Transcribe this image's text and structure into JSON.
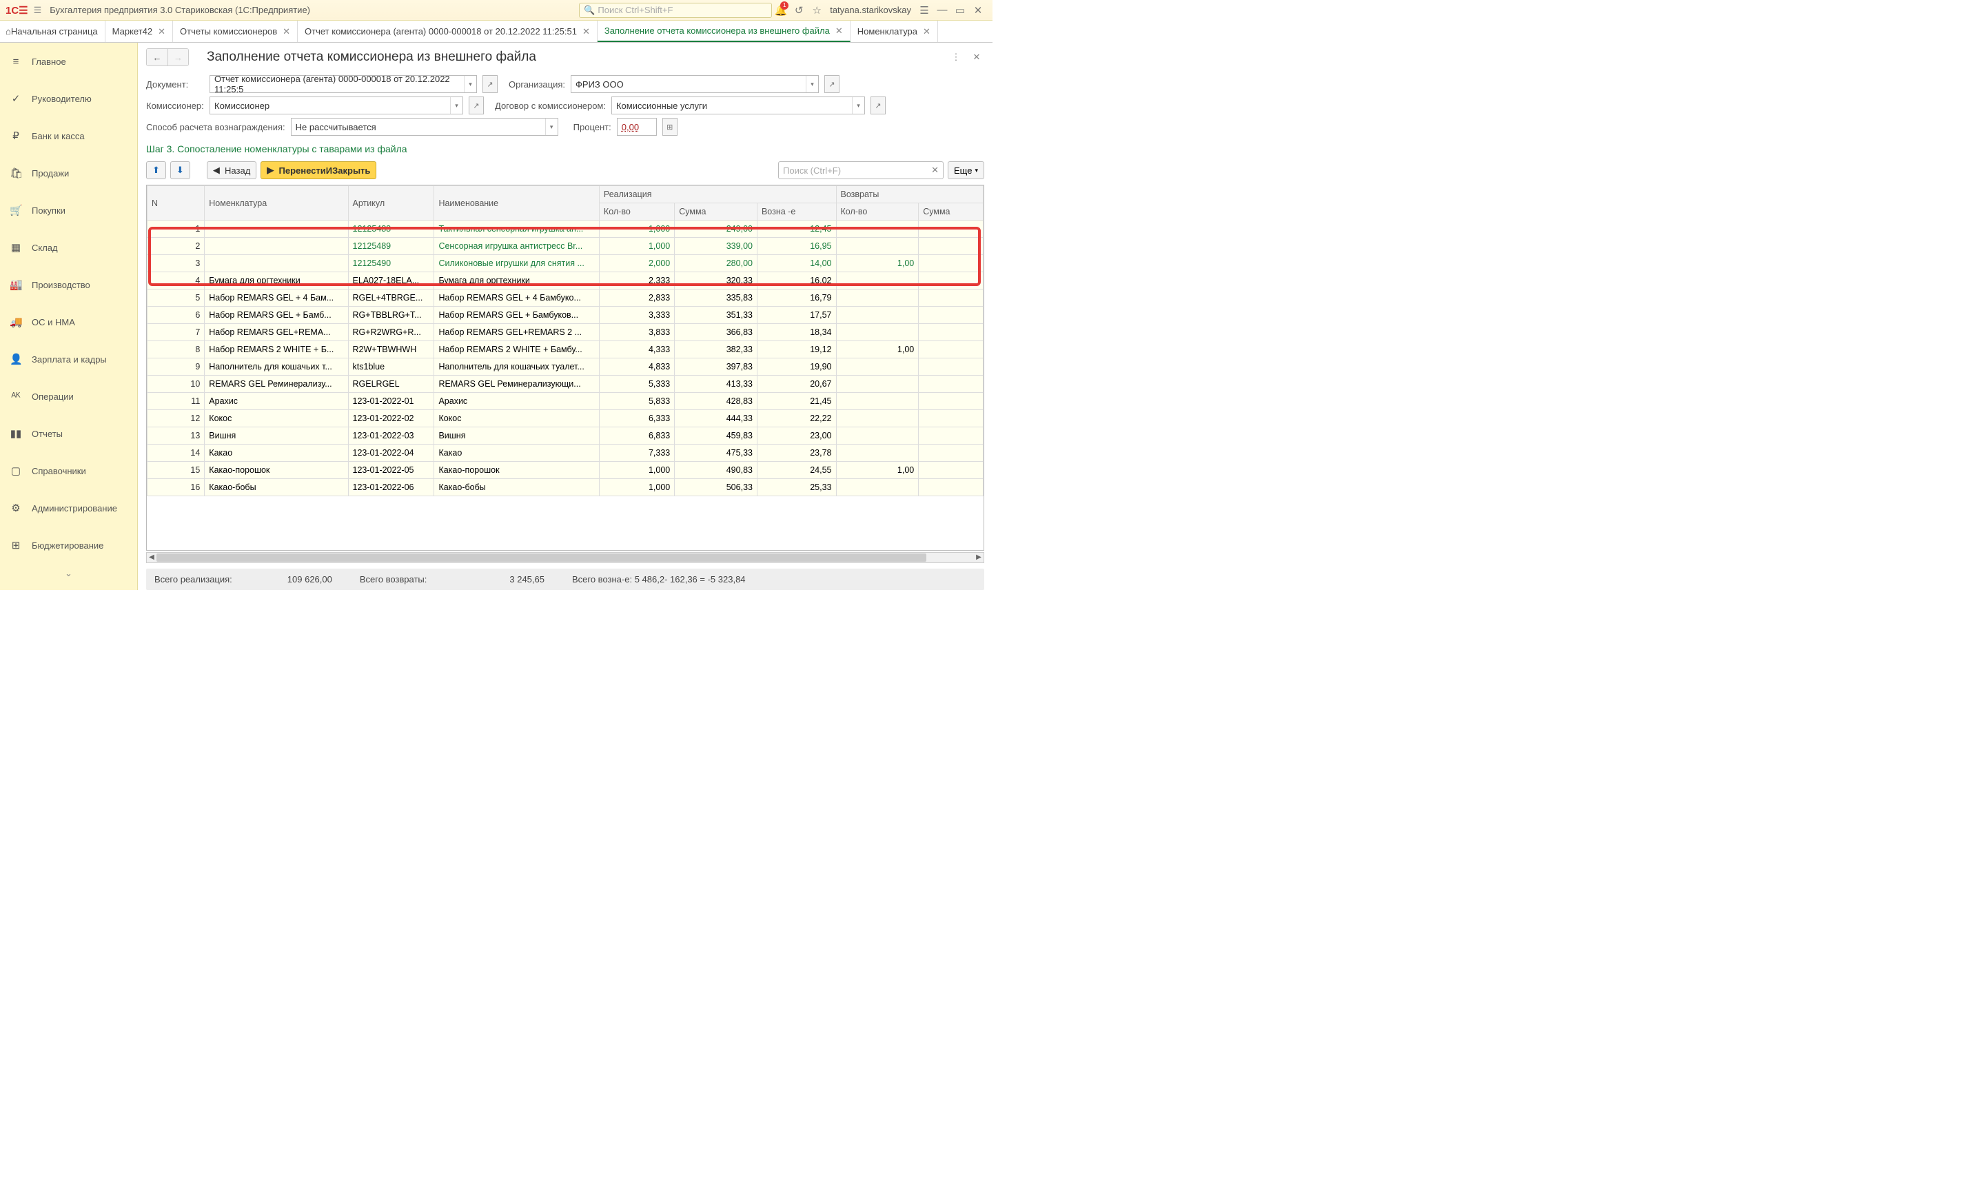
{
  "app": {
    "title": "Бухгалтерия предприятия 3.0 Стариковская  (1С:Предприятие)",
    "search_placeholder": "Поиск Ctrl+Shift+F",
    "username": "tatyana.starikovskay",
    "bell_badge": "1"
  },
  "tabs": [
    {
      "label": "Начальная страница",
      "closable": false,
      "home": true
    },
    {
      "label": "Маркет42",
      "closable": true
    },
    {
      "label": "Отчеты комиссионеров",
      "closable": true
    },
    {
      "label": "Отчет комиссионера (агента) 0000-000018 от 20.12.2022 11:25:51",
      "closable": true
    },
    {
      "label": "Заполнение  отчета комиссионера из внешнего  файла",
      "closable": true,
      "active": true
    },
    {
      "label": "Номенклатура",
      "closable": true
    }
  ],
  "sidebar": [
    {
      "icon": "≡",
      "label": "Главное"
    },
    {
      "icon": "✓",
      "label": "Руководителю"
    },
    {
      "icon": "₽",
      "label": "Банк и касса"
    },
    {
      "icon": "🛍",
      "label": "Продажи"
    },
    {
      "icon": "🛒",
      "label": "Покупки"
    },
    {
      "icon": "▦",
      "label": "Склад"
    },
    {
      "icon": "🏭",
      "label": "Производство"
    },
    {
      "icon": "🚚",
      "label": "ОС и НМА"
    },
    {
      "icon": "👤",
      "label": "Зарплата и кадры"
    },
    {
      "icon": "ᴬᴷ",
      "label": "Операции"
    },
    {
      "icon": "▮▮",
      "label": "Отчеты"
    },
    {
      "icon": "▢",
      "label": "Справочники"
    },
    {
      "icon": "⚙",
      "label": "Администрирование"
    },
    {
      "icon": "⊞",
      "label": "Бюджетирование"
    }
  ],
  "page": {
    "title": "Заполнение  отчета комиссионера из внешнего  файла",
    "labels": {
      "document": "Документ:",
      "organization": "Организация:",
      "commissioner": "Комиссионер:",
      "contract": "Договор с комиссионером:",
      "method": "Способ расчета вознаграждения:",
      "percent": "Процент:"
    },
    "values": {
      "document": "Отчет комиссионера (агента) 0000-000018 от 20.12.2022 11:25:5",
      "organization": "ФРИЗ ООО",
      "commissioner": "Комиссионер",
      "contract": "Комиссионные услуги",
      "method": "Не рассчитывается",
      "percent": "0,00"
    },
    "step": "Шаг 3. Сопосталение номенклатуры с таварами из файла",
    "buttons": {
      "back": "Назад",
      "transfer": "ПеренестиИЗакрыть",
      "search_ph": "Поиск (Ctrl+F)",
      "more": "Еще"
    }
  },
  "table": {
    "headers": {
      "n": "N",
      "nomen": "Номенклатура",
      "article": "Артикул",
      "name": "Наименование",
      "real": "Реализация",
      "qty": "Кол-во",
      "sum": "Сумма",
      "reward": "Возна -е",
      "returns": "Возвраты",
      "ret_qty": "Кол-во",
      "ret_sum": "Сумма"
    },
    "rows": [
      {
        "n": 1,
        "nomen": "",
        "article": "12125488",
        "name": "Тактильная сенсорная игрушка ан...",
        "qty": "1,000",
        "sum": "249,00",
        "reward": "12,45",
        "ret_qty": "",
        "green": true
      },
      {
        "n": 2,
        "nomen": "",
        "article": "12125489",
        "name": "Сенсорная игрушка антистресс Br...",
        "qty": "1,000",
        "sum": "339,00",
        "reward": "16,95",
        "ret_qty": "",
        "green": true
      },
      {
        "n": 3,
        "nomen": "",
        "article": "12125490",
        "name": "Силиконовые игрушки для снятия ...",
        "qty": "2,000",
        "sum": "280,00",
        "reward": "14,00",
        "ret_qty": "1,00",
        "green": true
      },
      {
        "n": 4,
        "nomen": "Бумага для оргтехники",
        "article": "ELA027-18ELA...",
        "name": "Бумага для оргтехники",
        "qty": "2,333",
        "sum": "320,33",
        "reward": "16,02",
        "ret_qty": ""
      },
      {
        "n": 5,
        "nomen": "Набор REMARS GEL + 4 Бам...",
        "article": "RGEL+4TBRGE...",
        "name": "Набор REMARS GEL + 4 Бамбуко...",
        "qty": "2,833",
        "sum": "335,83",
        "reward": "16,79",
        "ret_qty": ""
      },
      {
        "n": 6,
        "nomen": "Набор REMARS GEL + Бамб...",
        "article": "RG+TBBLRG+T...",
        "name": "Набор REMARS GEL + Бамбуков...",
        "qty": "3,333",
        "sum": "351,33",
        "reward": "17,57",
        "ret_qty": ""
      },
      {
        "n": 7,
        "nomen": "Набор REMARS GEL+REMA...",
        "article": "RG+R2WRG+R...",
        "name": "Набор REMARS GEL+REMARS 2 ...",
        "qty": "3,833",
        "sum": "366,83",
        "reward": "18,34",
        "ret_qty": ""
      },
      {
        "n": 8,
        "nomen": "Набор REMARS 2 WHITE + Б...",
        "article": "R2W+TBWHWH",
        "name": "Набор REMARS 2 WHITE + Бамбу...",
        "qty": "4,333",
        "sum": "382,33",
        "reward": "19,12",
        "ret_qty": "1,00"
      },
      {
        "n": 9,
        "nomen": "Наполнитель для кошачьих т...",
        "article": "kts1blue",
        "name": "Наполнитель для кошачьих туалет...",
        "qty": "4,833",
        "sum": "397,83",
        "reward": "19,90",
        "ret_qty": ""
      },
      {
        "n": 10,
        "nomen": "REMARS GEL Реминерализу...",
        "article": "RGELRGEL",
        "name": "REMARS GEL Реминерализующи...",
        "qty": "5,333",
        "sum": "413,33",
        "reward": "20,67",
        "ret_qty": ""
      },
      {
        "n": 11,
        "nomen": "Арахис",
        "article": "123-01-2022-01",
        "name": "Арахис",
        "qty": "5,833",
        "sum": "428,83",
        "reward": "21,45",
        "ret_qty": ""
      },
      {
        "n": 12,
        "nomen": "Кокос",
        "article": "123-01-2022-02",
        "name": "Кокос",
        "qty": "6,333",
        "sum": "444,33",
        "reward": "22,22",
        "ret_qty": ""
      },
      {
        "n": 13,
        "nomen": "Вишня",
        "article": "123-01-2022-03",
        "name": "Вишня",
        "qty": "6,833",
        "sum": "459,83",
        "reward": "23,00",
        "ret_qty": ""
      },
      {
        "n": 14,
        "nomen": "Какао",
        "article": "123-01-2022-04",
        "name": "Какао",
        "qty": "7,333",
        "sum": "475,33",
        "reward": "23,78",
        "ret_qty": ""
      },
      {
        "n": 15,
        "nomen": "Какао-порошок",
        "article": "123-01-2022-05",
        "name": "Какао-порошок",
        "qty": "1,000",
        "sum": "490,83",
        "reward": "24,55",
        "ret_qty": "1,00"
      },
      {
        "n": 16,
        "nomen": "Какао-бобы",
        "article": "123-01-2022-06",
        "name": "Какао-бобы",
        "qty": "1,000",
        "sum": "506,33",
        "reward": "25,33",
        "ret_qty": ""
      }
    ]
  },
  "totals": {
    "real_label": "Всего реализация:",
    "real_value": "109 626,00",
    "ret_label": "Всего возвраты:",
    "ret_value": "3 245,65",
    "reward_label": "Всего возна-е:",
    "reward_value": "5 486,2- 162,36 = -5 323,84"
  }
}
